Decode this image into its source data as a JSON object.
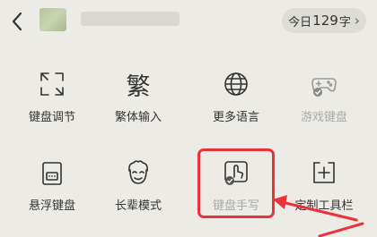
{
  "header": {
    "back_icon": "chevron-left-icon",
    "count_prefix": "今日",
    "count_value": "129",
    "count_suffix": "字",
    "count_chevron": "›"
  },
  "grid": [
    {
      "label": "键盘调节",
      "icon": "resize-frame-icon",
      "enabled": true
    },
    {
      "label": "繁体输入",
      "icon": "traditional-char-icon",
      "glyph": "繁",
      "enabled": true
    },
    {
      "label": "更多语言",
      "icon": "globe-icon",
      "enabled": true
    },
    {
      "label": "游戏键盘",
      "icon": "gamepad-icon",
      "enabled": false
    },
    {
      "label": "悬浮键盘",
      "icon": "floating-keyboard-icon",
      "enabled": true
    },
    {
      "label": "长辈模式",
      "icon": "elder-face-icon",
      "enabled": true
    },
    {
      "label": "键盘手写",
      "icon": "handwriting-icon",
      "enabled": false
    },
    {
      "label": "定制工具栏",
      "icon": "custom-toolbar-icon",
      "enabled": true
    }
  ],
  "colors": {
    "background": "#ecebe6",
    "highlight": "#e8333a",
    "text": "#333333",
    "disabled_text": "#aaaaaa"
  }
}
